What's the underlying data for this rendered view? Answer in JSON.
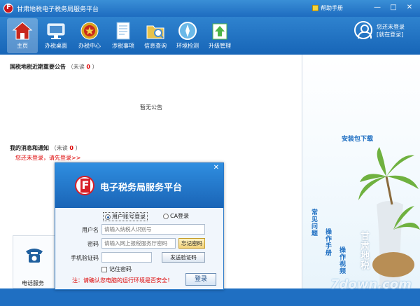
{
  "window": {
    "title": "甘肃地税电子税务局服务平台",
    "help": "帮助手册",
    "minimize": "—",
    "maximize": "□",
    "close": "✕"
  },
  "toolbar": {
    "items": [
      {
        "label": "主页",
        "icon": "home-icon",
        "color": "#c8281e"
      },
      {
        "label": "办税桌面",
        "icon": "monitor-icon",
        "color": "#4a8ed0"
      },
      {
        "label": "办税中心",
        "icon": "emblem-icon",
        "color": "#d8a51f"
      },
      {
        "label": "涉税事项",
        "icon": "document-icon",
        "color": "#7ab0df"
      },
      {
        "label": "信息查询",
        "icon": "folder-search-icon",
        "color": "#e8c24a"
      },
      {
        "label": "环境检测",
        "icon": "compass-icon",
        "color": "#6ab8e8"
      },
      {
        "label": "升级管理",
        "icon": "upgrade-icon",
        "color": "#4fb548"
      }
    ]
  },
  "user": {
    "status": "您还未登录",
    "login_link": "[就在登录]"
  },
  "announcements": {
    "title": "国税地税近期重要公告",
    "unread_prefix": "（未读",
    "unread_count": "0",
    "unread_suffix": "）",
    "empty": "暂无公告"
  },
  "messages": {
    "title": "我的消息和通知",
    "unread_prefix": "（未读",
    "unread_count": "0",
    "unread_suffix": "）",
    "login_hint": "您还未登录，请先登录>>"
  },
  "services": {
    "phone_label": "电话服务"
  },
  "right_panel": {
    "download": "安装包下载",
    "faq": "常见问题",
    "manual": "操作手册",
    "video": "操作视频",
    "brand_vertical": "甘肃地税"
  },
  "watermark": "7down.com",
  "login_dialog": {
    "title": "电子税务局服务平台",
    "close": "✕",
    "tab_account": "用户账号登录",
    "tab_ca": "CA登录",
    "username_label": "用户名",
    "username_placeholder": "请输入纳税人识别号",
    "password_label": "密码",
    "password_placeholder": "请输入网上报税服务厅密码",
    "forgot_password": "忘记密码",
    "sms_label": "手机验证码",
    "sms_placeholder": "",
    "send_code": "发送验证码",
    "remember": "记住密码",
    "warning": "注：请确认您电脑的运行环境是否安全！",
    "login_button": "登录"
  }
}
